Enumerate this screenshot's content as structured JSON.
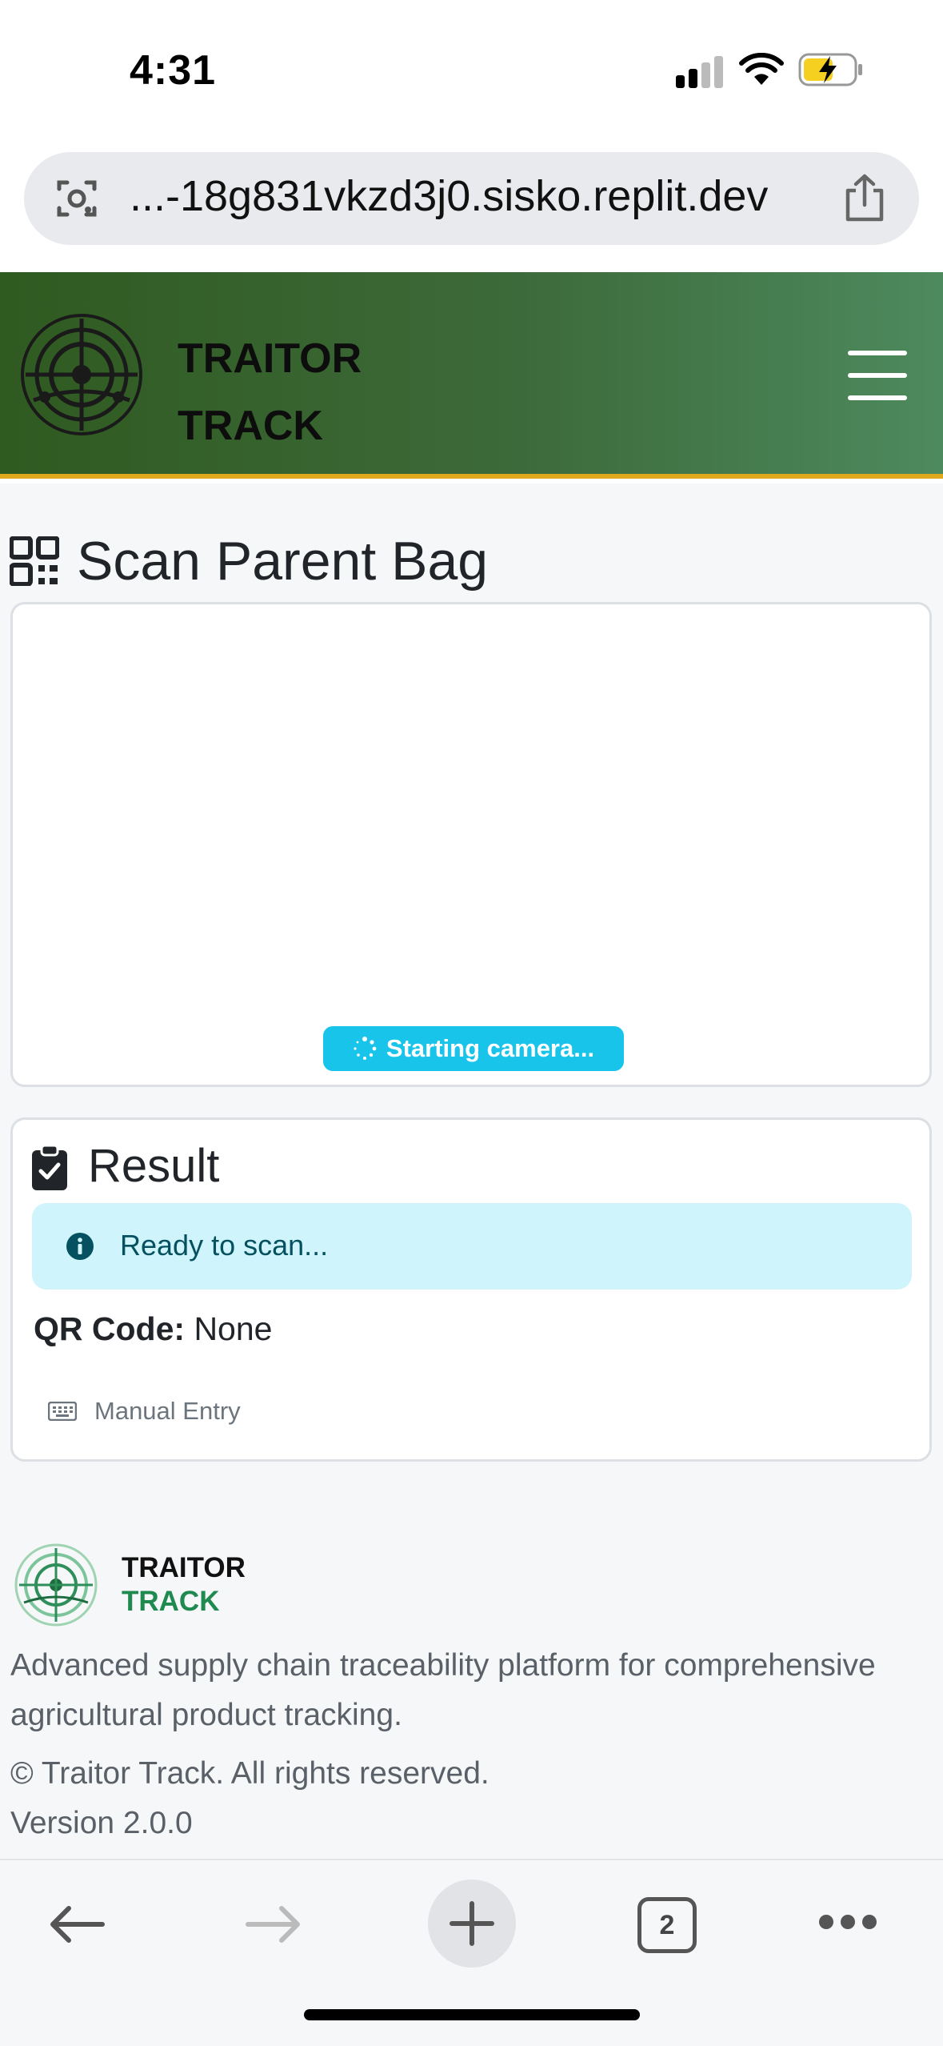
{
  "status_bar": {
    "time": "4:31"
  },
  "browser": {
    "url": "...-18g831vkzd3j0.sisko.replit.dev",
    "tab_count": "2"
  },
  "header": {
    "brand_line1": "TRAITOR",
    "brand_line2": "TRACK"
  },
  "page": {
    "title": "Scan Parent Bag",
    "scanner_status": "Starting camera..."
  },
  "result": {
    "title": "Result",
    "alert": "Ready to scan...",
    "qr_label": "QR Code:",
    "qr_value": "None",
    "manual_entry": "Manual Entry"
  },
  "footer": {
    "brand_line1": "TRAITOR",
    "brand_line2": "TRACK",
    "description": "Advanced supply chain traceability platform for comprehensive agricultural product tracking.",
    "copyright": "© Traitor Track. All rights reserved.",
    "version": "Version 2.0.0"
  },
  "colors": {
    "header_start": "#2f5a20",
    "header_end": "#4d8a5e",
    "header_border": "#e0a81c",
    "scan_badge": "#18c4ea",
    "info_bg": "#cff4fc",
    "footer_track": "#1e8a4f"
  },
  "icons": {
    "url_left": "camera-search-icon",
    "url_right": "share-icon",
    "title": "qrcode-icon",
    "result": "clipboard-check-icon",
    "alert": "info-circle-icon",
    "manual": "keyboard-icon",
    "menu": "hamburger-menu-icon"
  }
}
